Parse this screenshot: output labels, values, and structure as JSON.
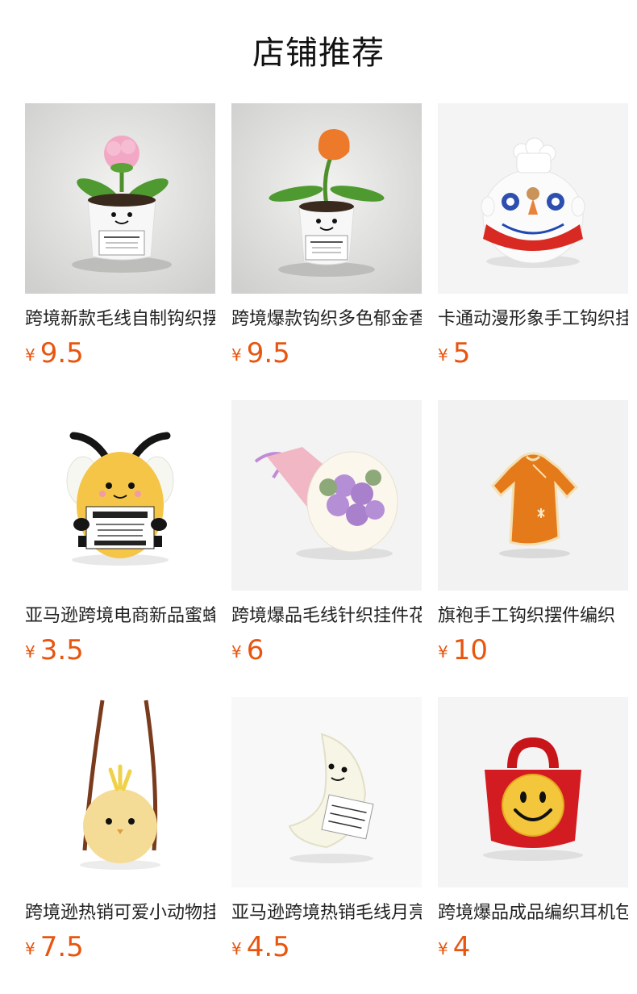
{
  "title": "店铺推荐",
  "currency": "¥",
  "products": [
    {
      "name": "跨境新款毛线自制钩织摆件",
      "price": "9.5",
      "icon": "flower-pot-crochet-icon"
    },
    {
      "name": "跨境爆款钩织多色郁金香盆栽",
      "price": "9.5",
      "icon": "tulip-pot-crochet-icon"
    },
    {
      "name": "卡通动漫形象手工钩织挂件",
      "price": "5",
      "icon": "cartoon-character-crochet-icon"
    },
    {
      "name": "亚马逊跨境电商新品蜜蜂",
      "price": "3.5",
      "icon": "bee-crochet-icon"
    },
    {
      "name": "跨境爆品毛线针织挂件花束",
      "price": "6",
      "icon": "bouquet-crochet-icon"
    },
    {
      "name": "旗袍手工钩织摆件编织",
      "price": "10",
      "icon": "qipao-crochet-icon"
    },
    {
      "name": "跨境逊热销可爱小动物挂件",
      "price": "7.5",
      "icon": "chick-bag-crochet-icon"
    },
    {
      "name": "亚马逊跨境热销毛线月亮",
      "price": "4.5",
      "icon": "moon-crochet-icon"
    },
    {
      "name": "跨境爆品成品编织耳机包",
      "price": "4",
      "icon": "smiley-bag-crochet-icon"
    }
  ],
  "colors": {
    "price": "#e8550f",
    "title": "#111111",
    "text": "#222222"
  }
}
